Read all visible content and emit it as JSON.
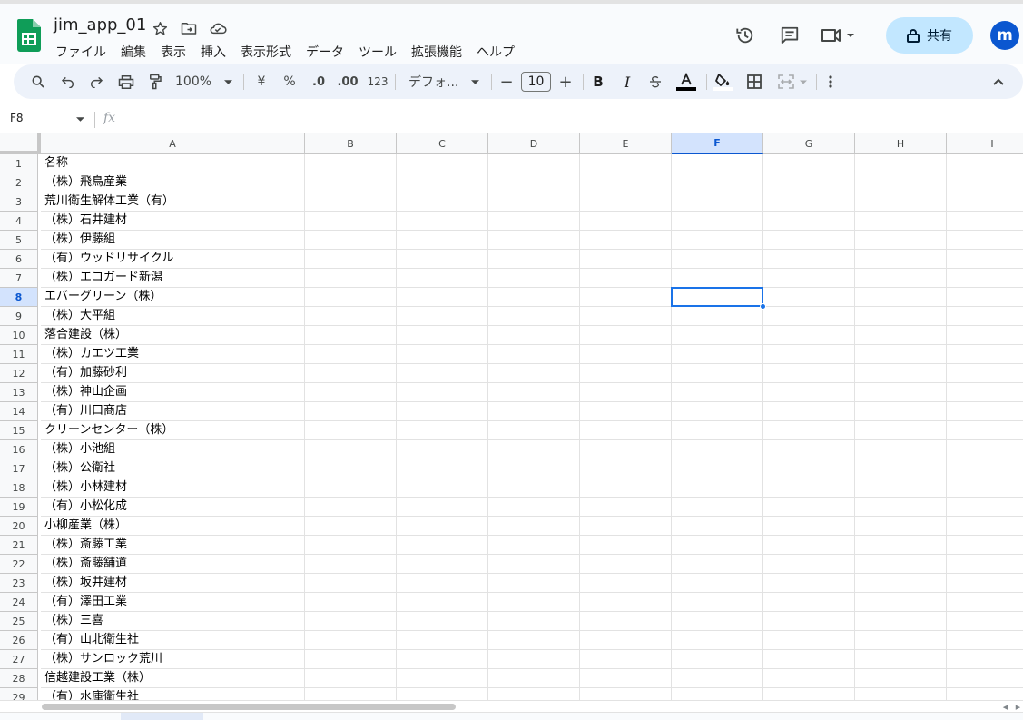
{
  "document": {
    "title": "jim_app_01"
  },
  "menubar": [
    "ファイル",
    "編集",
    "表示",
    "挿入",
    "表示形式",
    "データ",
    "ツール",
    "拡張機能",
    "ヘルプ"
  ],
  "header": {
    "share_label": "共有",
    "avatar_initial": "m"
  },
  "toolbar": {
    "zoom": "100%",
    "currency": "¥",
    "percent": "%",
    "decrease_decimal": ".0",
    "increase_decimal": ".00",
    "number_format": "123",
    "font": "デフォ...",
    "font_size": "10",
    "minus": "−",
    "plus": "+",
    "bold": "B",
    "italic": "I"
  },
  "formula_bar": {
    "cell_ref": "F8",
    "fx": "fx",
    "value": ""
  },
  "grid": {
    "columns": [
      "A",
      "B",
      "C",
      "D",
      "E",
      "F",
      "G",
      "H",
      "I"
    ],
    "selected_column": "F",
    "selected_row": "8",
    "rows": [
      {
        "num": "1",
        "a": "名称"
      },
      {
        "num": "2",
        "a": "（株）飛鳥産業"
      },
      {
        "num": "3",
        "a": "荒川衛生解体工業（有）"
      },
      {
        "num": "4",
        "a": "（株）石井建材"
      },
      {
        "num": "5",
        "a": "（株）伊藤組"
      },
      {
        "num": "6",
        "a": "（有）ウッドリサイクル"
      },
      {
        "num": "7",
        "a": "（株）エコガード新潟"
      },
      {
        "num": "8",
        "a": "エバーグリーン（株）"
      },
      {
        "num": "9",
        "a": "（株）大平組"
      },
      {
        "num": "10",
        "a": "落合建設（株）"
      },
      {
        "num": "11",
        "a": "（株）カエツ工業"
      },
      {
        "num": "12",
        "a": "（有）加藤砂利"
      },
      {
        "num": "13",
        "a": "（株）神山企画"
      },
      {
        "num": "14",
        "a": "（有）川口商店"
      },
      {
        "num": "15",
        "a": "クリーンセンター（株）"
      },
      {
        "num": "16",
        "a": "（株）小池組"
      },
      {
        "num": "17",
        "a": "（株）公衛社"
      },
      {
        "num": "18",
        "a": "（株）小林建材"
      },
      {
        "num": "19",
        "a": "（有）小松化成"
      },
      {
        "num": "20",
        "a": "小柳産業（株）"
      },
      {
        "num": "21",
        "a": "（株）斎藤工業"
      },
      {
        "num": "22",
        "a": "（株）斎藤舗道"
      },
      {
        "num": "23",
        "a": "（株）坂井建材"
      },
      {
        "num": "24",
        "a": "（有）澤田工業"
      },
      {
        "num": "25",
        "a": "（株）三喜"
      },
      {
        "num": "26",
        "a": "（有）山北衛生社"
      },
      {
        "num": "27",
        "a": "（株）サンロック荒川"
      },
      {
        "num": "28",
        "a": "信越建設工業（株）"
      },
      {
        "num": "29",
        "a": "（有）水庫衛生社"
      }
    ]
  },
  "colors": {
    "accent": "#0b57d0",
    "selection": "#1a73e8",
    "logo_green": "#0f9d58",
    "share_bg": "#c2e7ff"
  }
}
